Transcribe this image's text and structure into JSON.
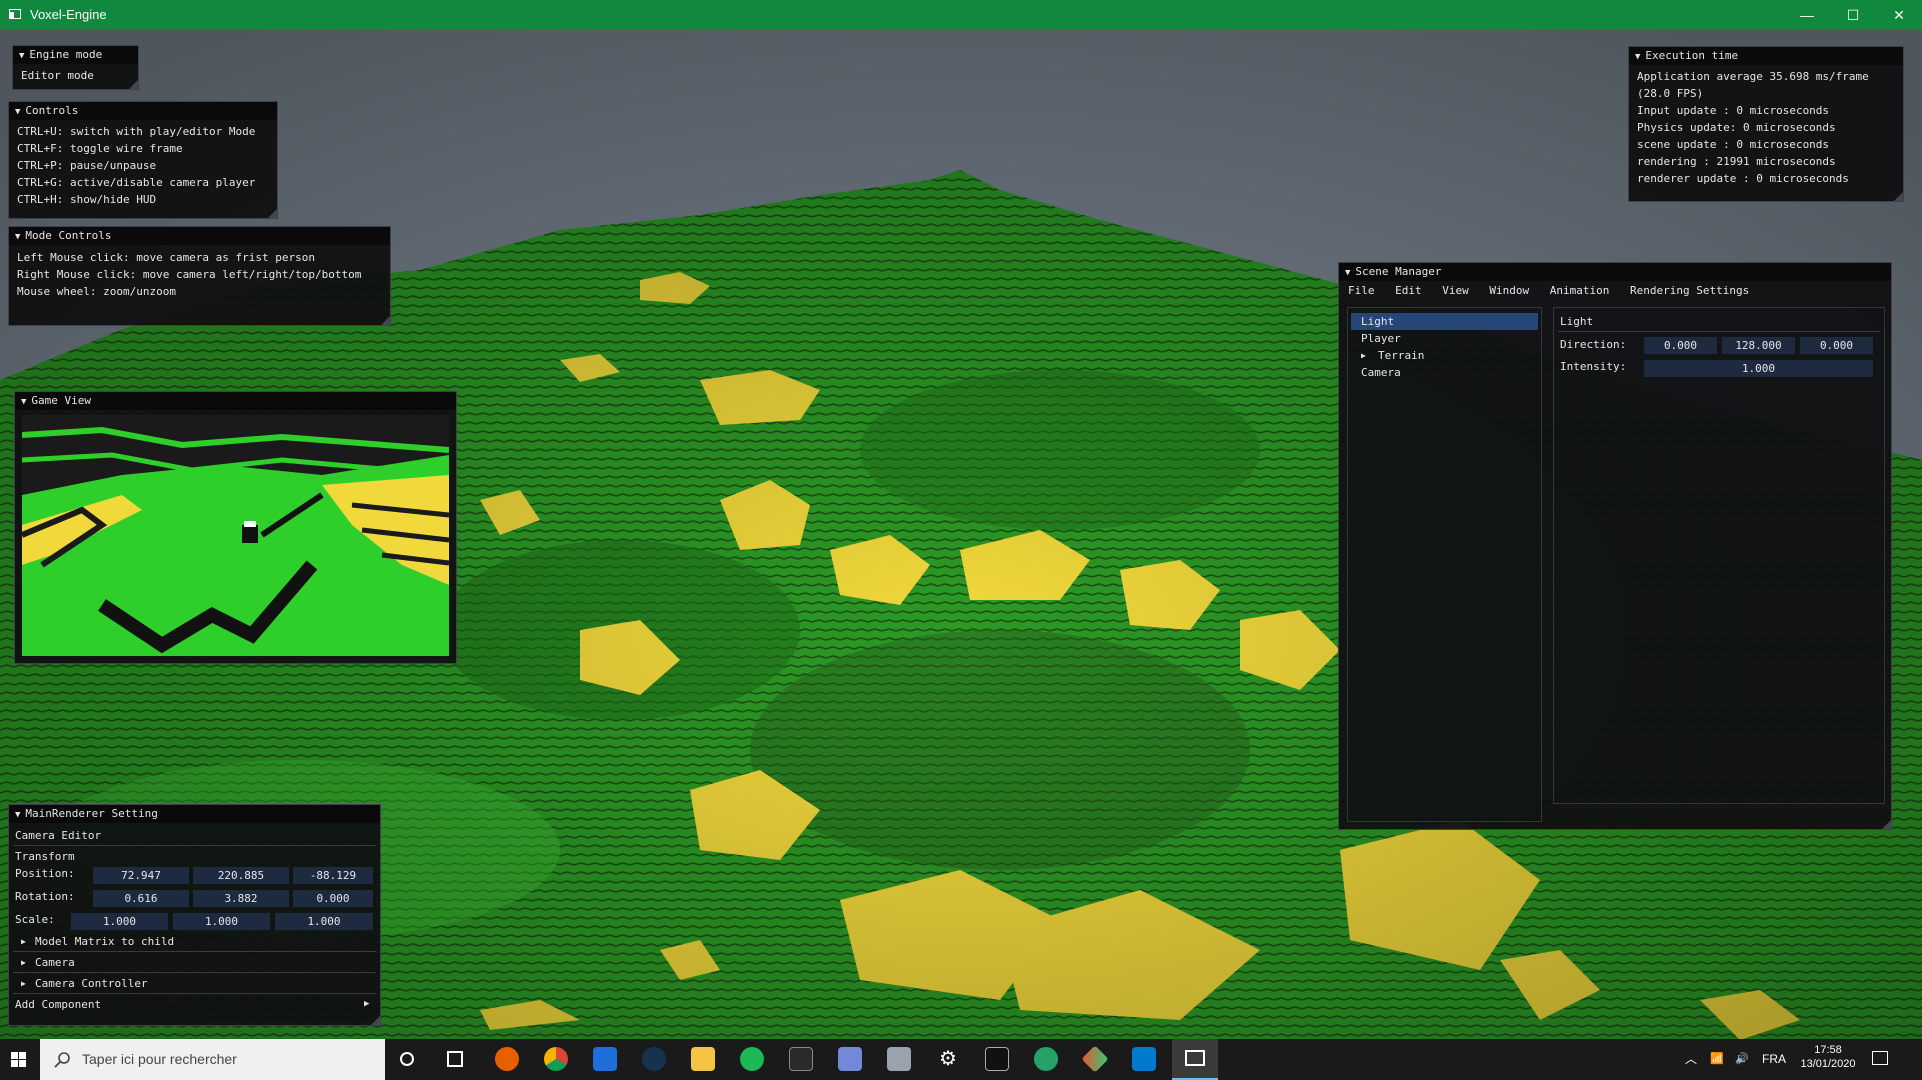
{
  "window": {
    "title": "Voxel-Engine",
    "minimize": "—",
    "maximize": "☐",
    "close": "✕"
  },
  "engine_mode": {
    "header": "Engine mode",
    "value": "Editor mode"
  },
  "controls": {
    "header": "Controls",
    "lines": [
      "CTRL+U: switch with play/editor Mode",
      "CTRL+F: toggle wire frame",
      "CTRL+P: pause/unpause",
      "CTRL+G: active/disable camera player",
      "CTRL+H: show/hide HUD"
    ]
  },
  "mode_controls": {
    "header": "Mode Controls",
    "lines": [
      "Left Mouse click: move camera as frist person",
      "Right Mouse click: move camera left/right/top/bottom",
      "Mouse wheel: zoom/unzoom"
    ]
  },
  "game_view": {
    "header": "Game View"
  },
  "execution_time": {
    "header": "Execution time",
    "lines": [
      "Application average 35.698 ms/frame",
      "(28.0 FPS)",
      "Input update : 0 microseconds",
      "Physics update: 0 microseconds",
      "scene update : 0 microseconds",
      "rendering : 21991 microseconds",
      "renderer update : 0 microseconds"
    ]
  },
  "scene_manager": {
    "header": "Scene Manager",
    "menu": [
      "File",
      "Edit",
      "View",
      "Window",
      "Animation",
      "Rendering Settings"
    ],
    "tree": [
      "Light",
      "Player",
      "Terrain",
      "Camera"
    ],
    "selected": "Light",
    "inspector_title": "Light",
    "direction_label": "Direction:",
    "direction": [
      "0.000",
      "128.000",
      "0.000"
    ],
    "intensity_label": "Intensity:",
    "intensity": "1.000"
  },
  "main_renderer": {
    "header": "MainRenderer Setting",
    "camera_editor": "Camera Editor",
    "transform": "Transform",
    "position_label": "Position:",
    "position": [
      "72.947",
      "220.885",
      "-88.129"
    ],
    "rotation_label": "Rotation:",
    "rotation": [
      "0.616",
      "3.882",
      "0.000"
    ],
    "scale_label": "Scale:",
    "scale": [
      "1.000",
      "1.000",
      "1.000"
    ],
    "model_matrix": "Model Matrix to child",
    "camera": "Camera",
    "camera_controller": "Camera Controller",
    "add_component": "Add Component"
  },
  "taskbar": {
    "search_placeholder": "Taper ici pour rechercher",
    "language": "FRA",
    "time": "17:58",
    "date": "13/01/2020"
  },
  "colors": {
    "titlebar": "#10893e",
    "terrain_green": "#2fb82a",
    "terrain_yellow": "#f2d93b",
    "selection": "#26467a"
  }
}
